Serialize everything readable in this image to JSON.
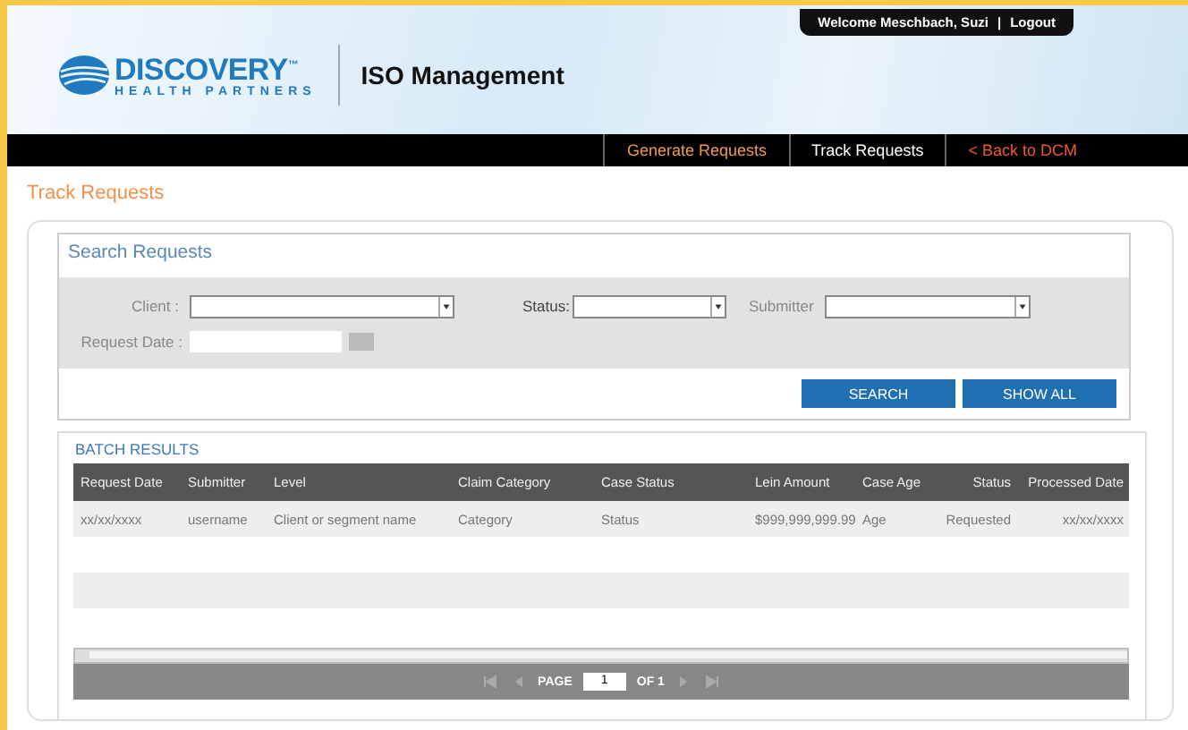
{
  "header": {
    "logo_name": "DISCOVERY",
    "logo_tm": "™",
    "logo_sub": "HEALTH PARTNERS",
    "app_title": "ISO Management",
    "welcome": "Welcome Meschbach, Suzi",
    "separator": "|",
    "logout": "Logout"
  },
  "nav": [
    {
      "label": "Generate Requests",
      "selected": false,
      "kind": "link"
    },
    {
      "label": "Track Requests",
      "selected": true,
      "kind": "link"
    },
    {
      "label": "< Back to DCM",
      "selected": false,
      "kind": "back"
    }
  ],
  "page_title": "Track Requests",
  "search": {
    "title": "Search Requests",
    "client_label": "Client :",
    "status_label": "Status:",
    "submitter_label": "Submitter",
    "request_date_label": "Request Date :",
    "buttons": [
      "SEARCH",
      "SHOW ALL"
    ]
  },
  "results": {
    "title": "BATCH RESULTS",
    "columns": [
      "Request Date",
      "Submitter",
      "Level",
      "Claim Category",
      "Case Status",
      "Lein Amount",
      "Case Age",
      "Status",
      "Processed Date"
    ],
    "rows": [
      [
        "xx/xx/xxxx",
        "username",
        "Client or segment name",
        "Category",
        "Status",
        "$999,999,999.99",
        "Age",
        "Requested",
        "xx/xx/xxxx"
      ]
    ],
    "pager": {
      "page_label": "PAGE",
      "page": "1",
      "of_label": "OF 1"
    }
  }
}
